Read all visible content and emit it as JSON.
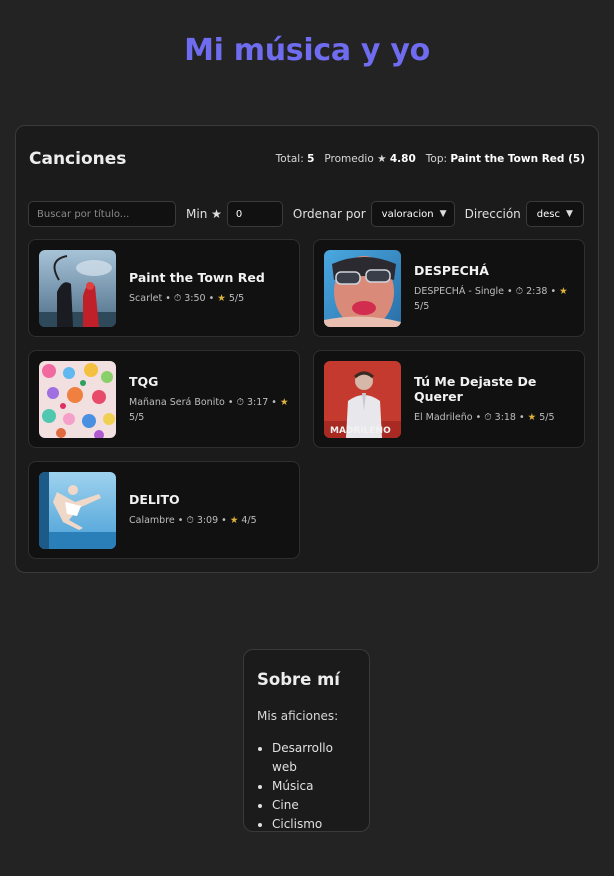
{
  "title": "Mi música y yo",
  "songs_panel": {
    "heading": "Canciones",
    "stats": {
      "total_label": "Total:",
      "total_value": "5",
      "avg_label": "Promedio ★",
      "avg_value": "4.80",
      "top_label": "Top:",
      "top_value": "Paint the Town Red (5)"
    },
    "controls": {
      "search_placeholder": "Buscar por título...",
      "min_label": "Min ★",
      "min_value": "0",
      "sort_label": "Ordenar por",
      "sort_value": "valoracion",
      "direction_label": "Dirección",
      "direction_value": "desc"
    },
    "songs": [
      {
        "title": "Paint the Town Red",
        "meta": "Scarlet • ⏱ 3:50 •",
        "rating": "5/5",
        "cover": "scarlet"
      },
      {
        "title": "DESPECHÁ",
        "meta": "DESPECHÁ - Single • ⏱ 2:38 •",
        "rating": "5/5",
        "cover": "despecha"
      },
      {
        "title": "TQG",
        "meta": "Mañana Será Bonito • ⏱ 3:17 •",
        "rating": "5/5",
        "cover": "manana"
      },
      {
        "title": "Tú Me Dejaste De Querer",
        "meta": "El Madrileño • ⏱ 3:18 •",
        "rating": "5/5",
        "cover": "madrileno"
      },
      {
        "title": "DELITO",
        "meta": "Calambre • ⏱ 3:09 •",
        "rating": "4/5",
        "cover": "calambre"
      }
    ],
    "cover_text": {
      "madrileno": "MADRILEÑO"
    }
  },
  "about": {
    "heading": "Sobre mí",
    "intro": "Mis aficiones:",
    "hobbies": [
      "Desarrollo web",
      "Música",
      "Cine",
      "Ciclismo"
    ]
  },
  "colors": {
    "accent": "#6f6cf0",
    "star": "#e0b43a",
    "background": "#232323"
  }
}
